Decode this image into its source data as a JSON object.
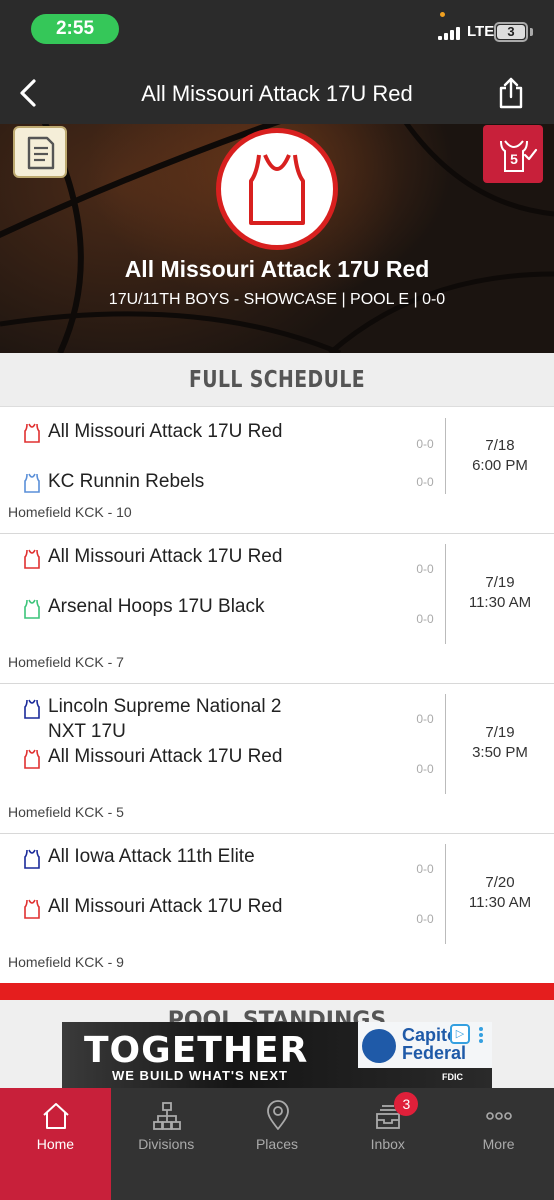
{
  "status_bar": {
    "time": "2:55",
    "network": "LTE",
    "battery": "3"
  },
  "nav": {
    "title": "All Missouri Attack 17U Red"
  },
  "hero": {
    "team_name": "All Missouri Attack 17U Red",
    "subtitle": "17U/11TH BOYS - SHOWCASE | POOL E | 0-0",
    "checkin_count": "5"
  },
  "schedule_heading": "FULL SCHEDULE",
  "games": [
    {
      "team1": {
        "name": "All Missouri Attack 17U Red",
        "score": "0-0",
        "jersey_color": "#e03030"
      },
      "team2": {
        "name": "KC Runnin Rebels",
        "score": "0-0",
        "jersey_color": "#5a8fd8"
      },
      "date": "7/18",
      "time": "6:00 PM",
      "venue": "Homefield KCK - 10"
    },
    {
      "team1": {
        "name": "All Missouri Attack 17U Red",
        "score": "0-0",
        "jersey_color": "#e03030"
      },
      "team2": {
        "name": "Arsenal Hoops 17U Black",
        "score": "0-0",
        "jersey_color": "#3cc47a"
      },
      "date": "7/19",
      "time": "11:30 AM",
      "venue": "Homefield KCK - 7"
    },
    {
      "team1": {
        "name": "Lincoln Supreme National 2 NXT 17U",
        "score": "0-0",
        "jersey_color": "#1a2a9a"
      },
      "team2": {
        "name": "All Missouri Attack 17U Red",
        "score": "0-0",
        "jersey_color": "#e03030"
      },
      "date": "7/19",
      "time": "3:50 PM",
      "venue": "Homefield KCK - 5"
    },
    {
      "team1": {
        "name": "All Iowa Attack 11th Elite",
        "score": "0-0",
        "jersey_color": "#1a2a9a"
      },
      "team2": {
        "name": "All Missouri Attack 17U Red",
        "score": "0-0",
        "jersey_color": "#e03030"
      },
      "date": "7/20",
      "time": "11:30 AM",
      "venue": "Homefield KCK - 9"
    }
  ],
  "standings_heading": "POOL STANDINGS",
  "ad": {
    "headline": "TOGETHER",
    "tagline": "WE BUILD WHAT'S NEXT",
    "brand": "Capitol Federal",
    "info": "▷",
    "fdic": "FDIC"
  },
  "tabs": [
    {
      "label": "Home",
      "icon": "home-icon",
      "active": true
    },
    {
      "label": "Divisions",
      "icon": "divisions-icon",
      "active": false
    },
    {
      "label": "Places",
      "icon": "places-icon",
      "active": false
    },
    {
      "label": "Inbox",
      "icon": "inbox-icon",
      "active": false,
      "badge": "3"
    },
    {
      "label": "More",
      "icon": "more-icon",
      "active": false
    }
  ]
}
